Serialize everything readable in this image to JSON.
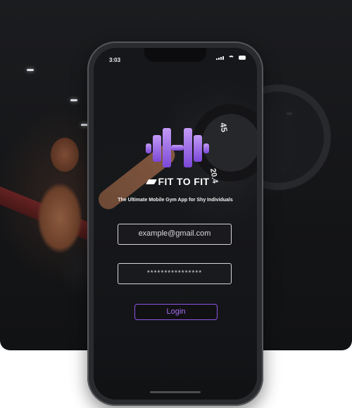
{
  "status_bar": {
    "time": "3:03"
  },
  "brand": {
    "name": "FIT TO FIT"
  },
  "tagline": "The Ultimate Mobile Gym App for Shy Individuals",
  "form": {
    "email_placeholder": "example@gmail.com",
    "password_value": "****************",
    "login_label": "Login"
  },
  "plate_labels": {
    "top": "45",
    "side": "20.4"
  },
  "colors": {
    "accent": "#8f56e6",
    "logo_gradient_top": "#c39af5",
    "logo_gradient_bottom": "#7c48d8",
    "background": "#141517"
  },
  "icons": [
    "signal-icon",
    "wifi-icon",
    "battery-icon",
    "barbell-logo-icon",
    "brand-mark-icon"
  ]
}
